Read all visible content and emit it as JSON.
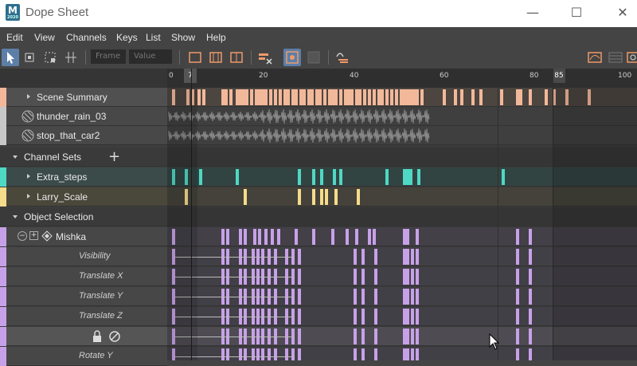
{
  "window": {
    "title": "Dope Sheet",
    "app_badge": "M",
    "app_sub": "2020"
  },
  "menu": [
    "Edit",
    "View",
    "Channels",
    "Keys",
    "List",
    "Show",
    "Help"
  ],
  "toolbar": {
    "frame_placeholder": "Frame",
    "value_placeholder": "Value"
  },
  "ruler": {
    "ticks": [
      "0",
      "20",
      "40",
      "60",
      "80",
      "100"
    ],
    "current_frame": "7",
    "end_frame": "85"
  },
  "outliner": {
    "scene_summary": "Scene Summary",
    "audio1": "thunder_rain_03",
    "audio2": "stop_that_car2",
    "channel_sets": "Channel Sets",
    "set1": "Extra_steps",
    "set2": "Larry_Scale",
    "object_selection": "Object Selection",
    "object": "Mishka",
    "channels": [
      "Visibility",
      "Translate X",
      "Translate Y",
      "Translate Z",
      "",
      "Rotate Y"
    ]
  },
  "colors": {
    "scene": "#f2b89a",
    "extra": "#4fd8c4",
    "larry": "#f4dc8a",
    "mishka": "#c7a1e8",
    "selected_tool": "#5c7fa8"
  }
}
